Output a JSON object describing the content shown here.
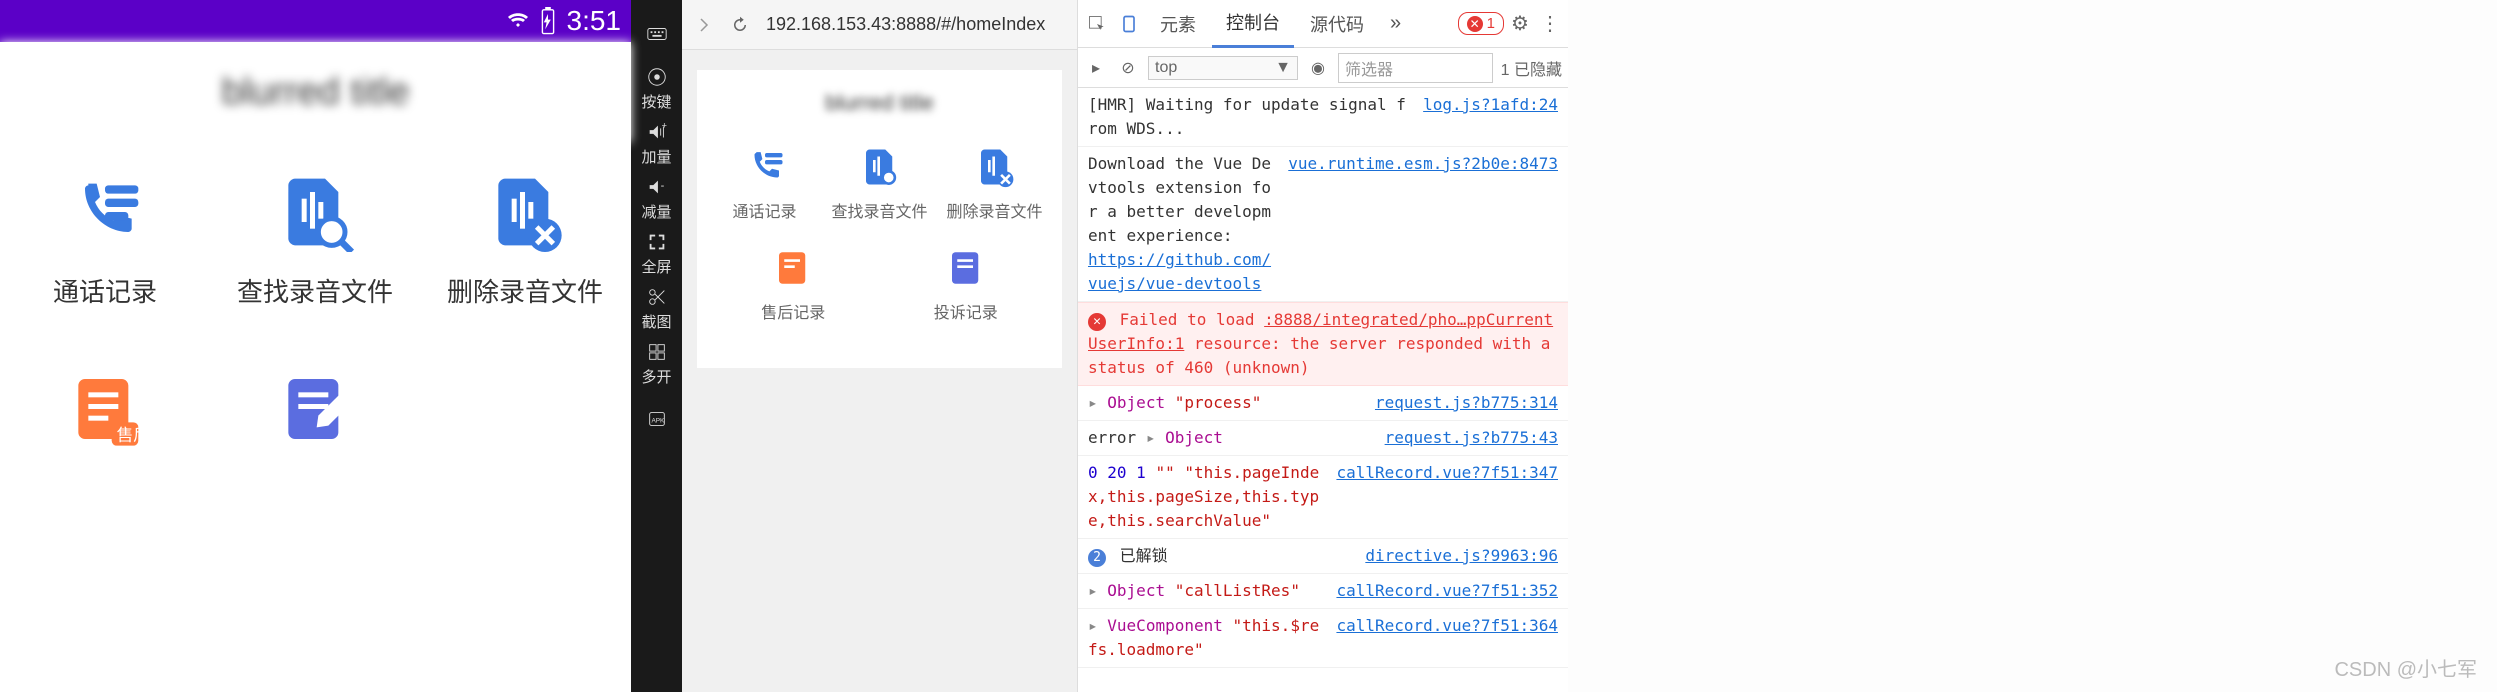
{
  "phone": {
    "status": {
      "time": "3:51"
    },
    "header_title": "blurred title",
    "items": [
      {
        "label": "通话记录",
        "icon": "call-log-icon"
      },
      {
        "label": "查找录音文件",
        "icon": "search-audio-icon"
      },
      {
        "label": "删除录音文件",
        "icon": "delete-audio-icon"
      },
      {
        "label": "",
        "icon": "aftersale-icon"
      },
      {
        "label": "",
        "icon": "edit-doc-icon"
      }
    ]
  },
  "toolbar": {
    "items": [
      {
        "label": "",
        "icon": "keyboard-icon"
      },
      {
        "label": "按键",
        "icon": "dpad-icon"
      },
      {
        "label": "加量",
        "icon": "volume-up-icon"
      },
      {
        "label": "减量",
        "icon": "volume-down-icon"
      },
      {
        "label": "全屏",
        "icon": "fullscreen-icon"
      },
      {
        "label": "截图",
        "icon": "scissors-icon"
      },
      {
        "label": "多开",
        "icon": "multi-icon"
      },
      {
        "label": "",
        "icon": "apk-icon"
      }
    ]
  },
  "browser": {
    "url": "192.168.153.43:8888/#/homeIndex",
    "preview_title": "blurred title",
    "items": [
      {
        "label": "通话记录",
        "icon": "call-log-icon"
      },
      {
        "label": "查找录音文件",
        "icon": "search-audio-icon"
      },
      {
        "label": "删除录音文件",
        "icon": "delete-audio-icon"
      },
      {
        "label": "售后记录",
        "icon": "aftersale-icon"
      },
      {
        "label": "投诉记录",
        "icon": "complaint-icon"
      }
    ]
  },
  "devtools": {
    "tabs": {
      "t0": "元素",
      "t1": "控制台",
      "t2": "源代码"
    },
    "err_count": "1",
    "context": "top",
    "filter_placeholder": "筛选器",
    "hidden_text": "1 已隐藏",
    "rows": {
      "r0_msg": "[HMR] Waiting for update signal from WDS...",
      "r0_src": "log.js?1afd:24",
      "r1_msg_a": "Download the Vue Devtools extension for a better development experience:",
      "r1_link": "https://github.com/vuejs/vue-devtools",
      "r1_src": "vue.runtime.esm.js?2b0e:8473",
      "r2_msg_a": "Failed to load",
      "r2_link": ":8888/integrated/pho…ppCurrentUserInfo:1",
      "r2_msg_b": "resource: the server responded with a status of 460 (unknown)",
      "r3_obj": "Object",
      "r3_str": "\"process\"",
      "r3_src": "request.js?b775:314",
      "r4_a": "error",
      "r4_obj": "Object",
      "r4_src": "request.js?b775:43",
      "r5_nums": "0 20 1",
      "r5_empty": "\"\"",
      "r5_str": "\"this.pageIndex,this.pageSize,this.type,this.searchValue\"",
      "r5_src": "callRecord.vue?7f51:347",
      "r6_txt": "已解锁",
      "r6_src": "directive.js?9963:96",
      "r7_obj": "Object",
      "r7_str": "\"callListRes\"",
      "r7_src": "callRecord.vue?7f51:352",
      "r8_comp": "VueComponent",
      "r8_str": "\"this.$refs.loadmore\"",
      "r8_src": "callRecord.vue?7f51:364"
    }
  },
  "csdn": "CSDN @小七军"
}
